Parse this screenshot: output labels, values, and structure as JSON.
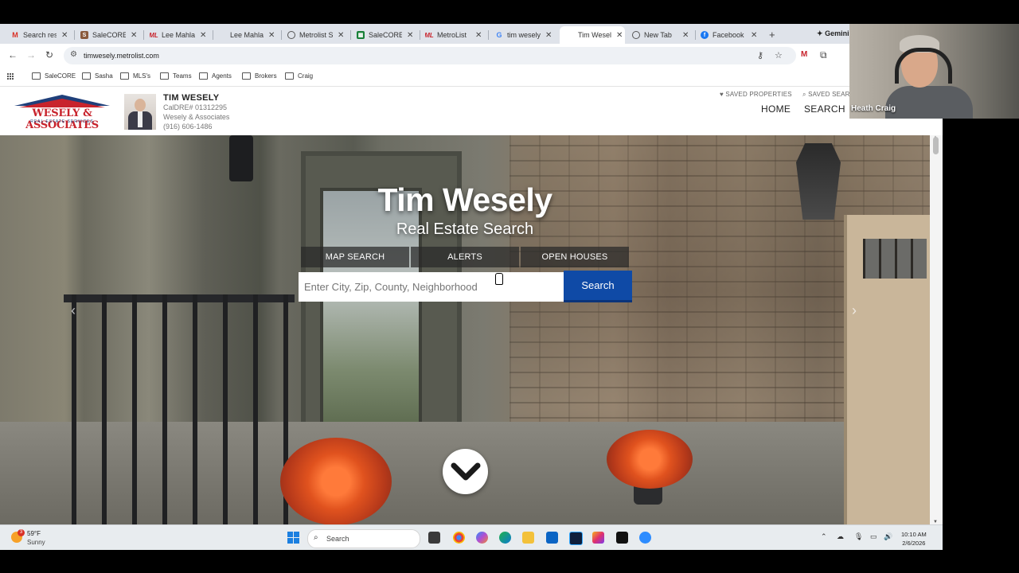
{
  "browser": {
    "tabs": [
      {
        "title": "Search resu",
        "icon": "gmail-icon",
        "color": "#d93025"
      },
      {
        "title": "SaleCORE",
        "icon": "salecore-icon",
        "color": "#8a5a3c"
      },
      {
        "title": "Lee Mahla",
        "icon": "metrolist-icon",
        "color": "#c8232c"
      },
      {
        "title": "Lee Mahla",
        "icon": "blank-icon",
        "color": "#ffffff"
      },
      {
        "title": "Metrolist S",
        "icon": "globe-icon",
        "color": "#555555"
      },
      {
        "title": "SaleCORE",
        "icon": "sheets-icon",
        "color": "#188038"
      },
      {
        "title": "MetroList",
        "icon": "metrolist-icon",
        "color": "#c8232c"
      },
      {
        "title": "tim wesely",
        "icon": "google-icon",
        "color": "#4285f4"
      },
      {
        "title": "Tim Wesely",
        "icon": "blank-icon",
        "color": "#ffffff",
        "active": true
      },
      {
        "title": "New Tab",
        "icon": "globe-icon",
        "color": "#555555"
      },
      {
        "title": "Facebook",
        "icon": "facebook-icon",
        "color": "#1877f2"
      }
    ],
    "gemini_label": "Gemini",
    "url": "timwesely.metrolist.com",
    "bookmarks": [
      "SaleCORE",
      "Sasha",
      "MLS's",
      "Teams",
      "Agents",
      "Brokers",
      "Craig"
    ]
  },
  "site": {
    "logo": {
      "name": "WESELY & ASSOCIATES",
      "tagline": "REAL ESTATE SERVICES"
    },
    "agent": {
      "name": "TIM WESELY",
      "license": "CalDRE# 01312295",
      "company": "Wesely & Associates",
      "phone": "(916) 606-1486"
    },
    "saved_properties": "SAVED PROPERTIES",
    "saved_searches": "SAVED SEAR",
    "nav": {
      "home": "HOME",
      "search": "SEARCH"
    }
  },
  "hero": {
    "title": "Tim Wesely",
    "subtitle": "Real Estate Search",
    "tabs": [
      "MAP SEARCH",
      "ALERTS",
      "OPEN HOUSES"
    ],
    "search_placeholder": "Enter City, Zip, County, Neighborhood",
    "search_button": "Search"
  },
  "taskbar": {
    "temperature": "59°F",
    "condition": "Sunny",
    "weather_badge": "3",
    "search_label": "Search",
    "time": "10:10 AM",
    "date": "2/6/2026"
  },
  "webcam": {
    "name": "Heath Craig"
  }
}
